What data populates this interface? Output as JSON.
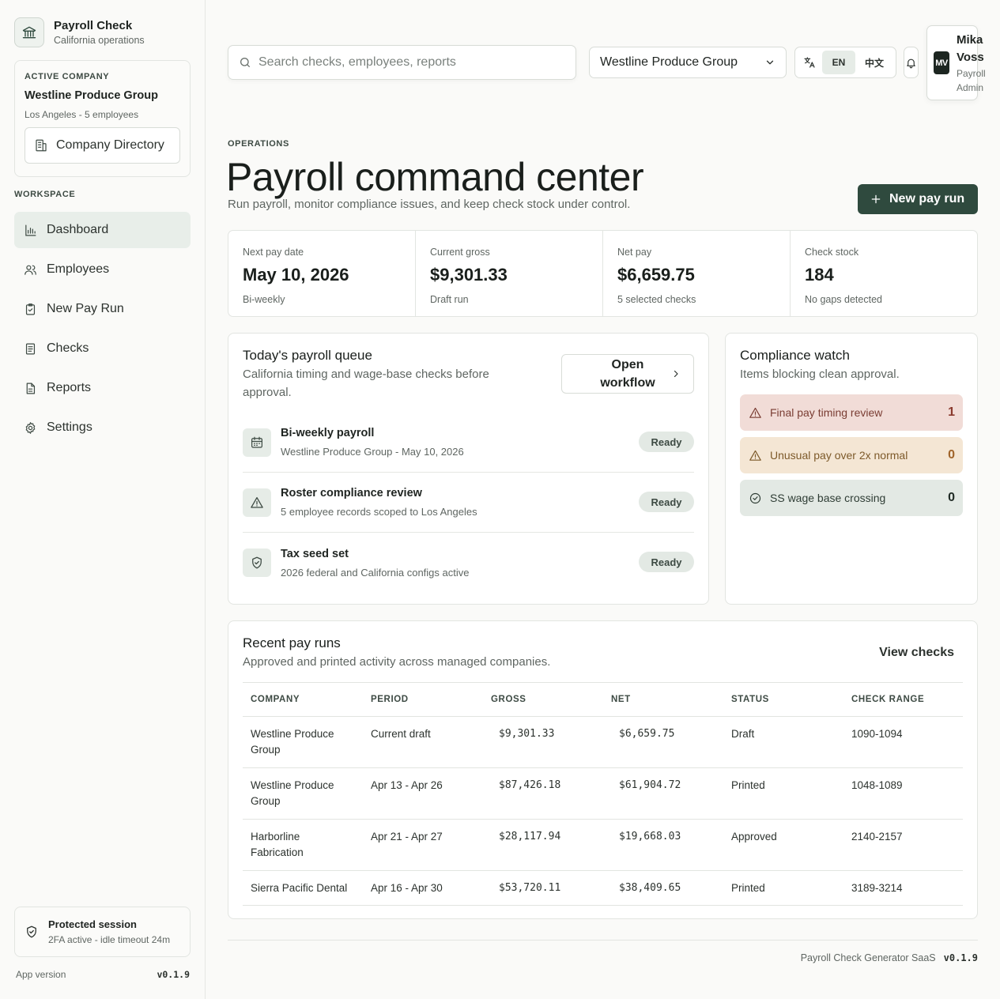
{
  "brand": {
    "name": "Payroll Check",
    "subtitle": "California operations"
  },
  "active_company": {
    "eyebrow": "ACTIVE COMPANY",
    "name": "Westline Produce Group",
    "meta": "Los Angeles - 5 employees",
    "directory_label": "Company Directory"
  },
  "sidebar": {
    "section_label": "WORKSPACE",
    "items": [
      {
        "label": "Dashboard",
        "icon": "bar-chart-icon"
      },
      {
        "label": "Employees",
        "icon": "users-icon"
      },
      {
        "label": "New Pay Run",
        "icon": "clipboard-check-icon"
      },
      {
        "label": "Checks",
        "icon": "document-icon"
      },
      {
        "label": "Reports",
        "icon": "file-text-icon"
      },
      {
        "label": "Settings",
        "icon": "gear-icon"
      }
    ],
    "active_index": 0
  },
  "session": {
    "title": "Protected session",
    "subtitle": "2FA active - idle timeout 24m"
  },
  "app_version": {
    "label": "App version",
    "value": "v0.1.9"
  },
  "topbar": {
    "search_placeholder": "Search checks, employees, reports",
    "company_select": "Westline Produce Group",
    "lang_en": "EN",
    "lang_zh": "中文",
    "user": {
      "initials": "MV",
      "first": "Mika",
      "last": "Voss",
      "role_line1": "Payroll",
      "role_line2": "Admin"
    }
  },
  "hero": {
    "eyebrow": "OPERATIONS",
    "title": "Payroll command center",
    "subtitle": "Run payroll, monitor compliance issues, and keep check stock under control.",
    "new_run_label": "New pay run"
  },
  "stats": [
    {
      "label": "Next pay date",
      "value": "May 10, 2026",
      "note": "Bi-weekly"
    },
    {
      "label": "Current gross",
      "value": "$9,301.33",
      "note": "Draft run"
    },
    {
      "label": "Net pay",
      "value": "$6,659.75",
      "note": "5 selected checks"
    },
    {
      "label": "Check stock",
      "value": "184",
      "note": "No gaps detected"
    }
  ],
  "queue": {
    "title": "Today's payroll queue",
    "subtitle": "California timing and wage-base checks before approval.",
    "open_label": "Open workflow",
    "items": [
      {
        "title": "Bi-weekly payroll",
        "sub": "Westline Produce Group - May 10, 2026",
        "status": "Ready",
        "icon": "calendar-icon"
      },
      {
        "title": "Roster compliance review",
        "sub": "5 employee records scoped to Los Angeles",
        "status": "Ready",
        "icon": "warning-icon"
      },
      {
        "title": "Tax seed set",
        "sub": "2026 federal and California configs active",
        "status": "Ready",
        "icon": "shield-check-icon"
      }
    ]
  },
  "compliance": {
    "title": "Compliance watch",
    "subtitle": "Items blocking clean approval.",
    "items": [
      {
        "label": "Final pay timing review",
        "count": "1",
        "tone": "red",
        "icon": "warning-icon"
      },
      {
        "label": "Unusual pay over 2x normal",
        "count": "0",
        "tone": "amber",
        "icon": "warning-icon"
      },
      {
        "label": "SS wage base crossing",
        "count": "0",
        "tone": "green",
        "icon": "check-circle-icon"
      }
    ]
  },
  "recent": {
    "title": "Recent pay runs",
    "subtitle": "Approved and printed activity across managed companies.",
    "view_label": "View checks",
    "columns": [
      "COMPANY",
      "PERIOD",
      "GROSS",
      "NET",
      "STATUS",
      "CHECK RANGE"
    ],
    "rows": [
      [
        "Westline Produce Group",
        "Current draft",
        "$9,301.33",
        "$6,659.75",
        "Draft",
        "1090-1094"
      ],
      [
        "Westline Produce Group",
        "Apr 13 - Apr 26",
        "$87,426.18",
        "$61,904.72",
        "Printed",
        "1048-1089"
      ],
      [
        "Harborline Fabrication",
        "Apr 21 - Apr 27",
        "$28,117.94",
        "$19,668.03",
        "Approved",
        "2140-2157"
      ],
      [
        "Sierra Pacific Dental",
        "Apr 16 - Apr 30",
        "$53,720.11",
        "$38,409.65",
        "Printed",
        "3189-3214"
      ]
    ]
  },
  "footer": {
    "text": "Payroll Check Generator SaaS",
    "version": "v0.1.9"
  }
}
